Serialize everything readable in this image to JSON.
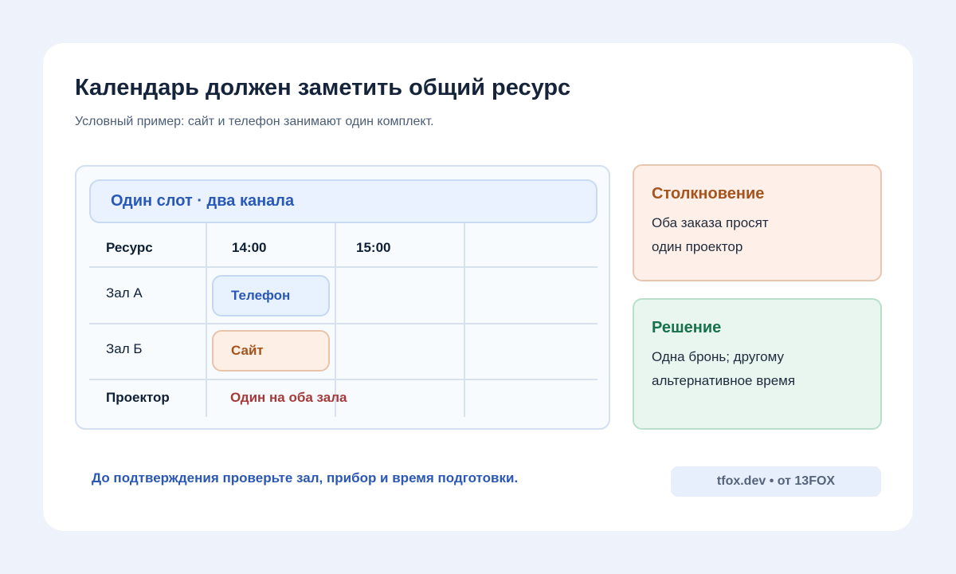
{
  "title": "Календарь должен заметить общий ресурс",
  "subtitle": "Условный пример: сайт и телефон занимают один комплект.",
  "schedule": {
    "header": "Один слот · два канала",
    "columns": [
      "Ресурс",
      "14:00",
      "15:00"
    ],
    "rows": [
      {
        "resource": "Зал А",
        "booking": "Телефон"
      },
      {
        "resource": "Зал Б",
        "booking": "Сайт"
      },
      {
        "resource": "Проектор",
        "booking": "Один на оба зала"
      }
    ]
  },
  "notes": {
    "conflict": {
      "title": "Столкновение",
      "line1": "Оба заказа просят",
      "line2": "один проектор"
    },
    "solution": {
      "title": "Решение",
      "line1": "Одна бронь; другому",
      "line2": "альтернативное время"
    }
  },
  "footer": {
    "hint": "До подтверждения проверьте зал, прибор и время подготовки.",
    "credit": "tfox.dev • от 13FOX"
  },
  "colors": {
    "page_bg": "#eef2fa",
    "accent_blue": "#2a58b4",
    "conflict_orange": "#a6521c",
    "solution_green": "#17724c",
    "shared_resource_red": "#a53a3a"
  }
}
